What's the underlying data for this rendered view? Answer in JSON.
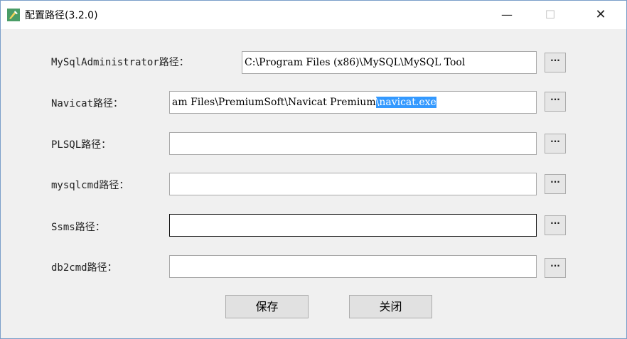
{
  "window": {
    "title": "配置路径(3.2.0)",
    "minimize_glyph": "—",
    "maximize_glyph": "☐",
    "close_glyph": "✕",
    "icon": "app-icon"
  },
  "fields": [
    {
      "label": "MySqlAdministrator路径：",
      "value": "C:\\Program Files (x86)\\MySQL\\MySQL Tool",
      "browse": "···"
    },
    {
      "label": "Navicat路径：",
      "value_pre": "am Files\\PremiumSoft\\Navicat Premium",
      "value_sel": "\\navicat.exe",
      "browse": "···"
    },
    {
      "label": "PLSQL路径：",
      "value": "",
      "browse": "···"
    },
    {
      "label": "mysqlcmd路径：",
      "value": "",
      "browse": "···"
    },
    {
      "label": "Ssms路径：",
      "value": "",
      "browse": "···"
    },
    {
      "label": "db2cmd路径：",
      "value": "",
      "browse": "···"
    }
  ],
  "buttons": {
    "save": "保存",
    "close": "关闭"
  },
  "colors": {
    "selection": "#3399ff",
    "window_bg": "#f0f0f0",
    "border": "#7a9ec9"
  }
}
